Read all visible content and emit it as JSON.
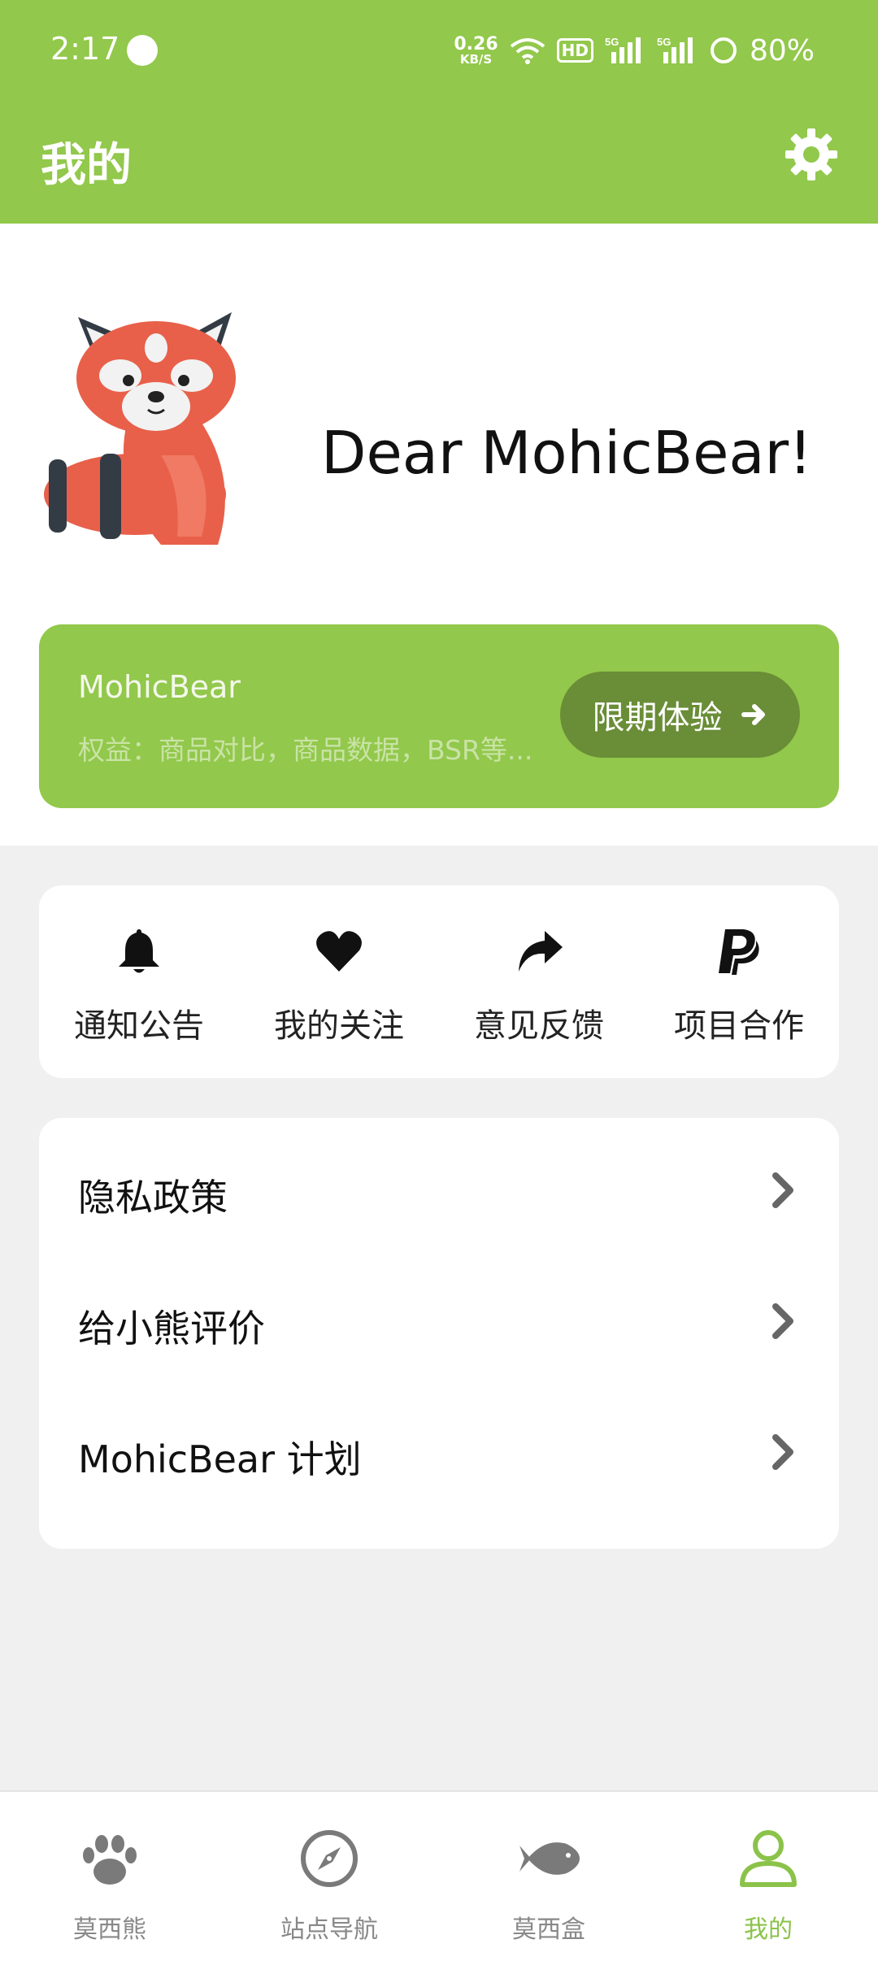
{
  "status_bar": {
    "time": "2:17",
    "net_speed_value": "0.26",
    "net_speed_unit": "KB/S",
    "hd_badge": "HD",
    "signal_1": "5G",
    "signal_2": "5G",
    "battery": "80%"
  },
  "header": {
    "title": "我的",
    "settings_icon": "gear-icon"
  },
  "profile": {
    "greeting": "Dear MohicBear!",
    "mascot": "red-panda-mascot"
  },
  "member_card": {
    "name": "MohicBear",
    "benefits": "权益：商品对比，商品数据，BSR等...",
    "trial_button": "限期体验"
  },
  "quick_actions": [
    {
      "label": "通知公告",
      "icon": "bell-icon"
    },
    {
      "label": "我的关注",
      "icon": "heart-icon"
    },
    {
      "label": "意见反馈",
      "icon": "share-arrow-icon"
    },
    {
      "label": "项目合作",
      "icon": "paypal-icon"
    }
  ],
  "menu_items": [
    {
      "label": "隐私政策"
    },
    {
      "label": "给小熊评价"
    },
    {
      "label": "MohicBear 计划"
    }
  ],
  "bottom_nav": [
    {
      "label": "莫西熊",
      "icon": "paw-icon",
      "active": false
    },
    {
      "label": "站点导航",
      "icon": "compass-icon",
      "active": false
    },
    {
      "label": "莫西盒",
      "icon": "fish-icon",
      "active": false
    },
    {
      "label": "我的",
      "icon": "user-icon",
      "active": true
    }
  ],
  "colors": {
    "brand_green": "#92c84b",
    "button_dark_green": "#6a8d37",
    "active_tab": "#8bc34a",
    "inactive_tab": "#888888"
  }
}
